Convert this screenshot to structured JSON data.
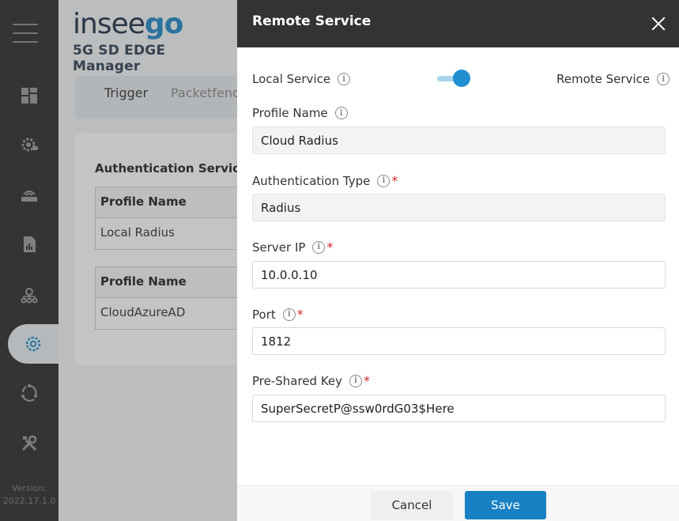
{
  "sidebar": {
    "icons": [
      "menu-icon",
      "dashboard-icon",
      "gear-cloud-icon",
      "router-icon",
      "report-icon",
      "network-icon",
      "settings-icon",
      "sync-icon",
      "tools-icon"
    ],
    "version_label": "Version:",
    "version_number": "2022.17.1.0"
  },
  "background": {
    "logo_main": "insee",
    "logo_accent": "go",
    "product_name": "5G SD EDGE Manager",
    "tabs": [
      {
        "label": "Trigger"
      },
      {
        "label": "Packetfence"
      }
    ],
    "section_title": "Authentication Service",
    "tables": [
      {
        "header": "Profile Name",
        "row": "Local Radius"
      },
      {
        "header": "Profile Name",
        "row": "CloudAzureAD"
      }
    ]
  },
  "modal": {
    "title": "Remote Service",
    "toggle": {
      "left_label": "Local Service",
      "right_label": "Remote Service",
      "selected": "Remote Service"
    },
    "fields": {
      "profile_name": {
        "label": "Profile Name",
        "value": "Cloud Radius",
        "required": false
      },
      "auth_type": {
        "label": "Authentication Type",
        "value": "Radius",
        "required": true
      },
      "server_ip": {
        "label": "Server IP",
        "value": "10.0.0.10",
        "required": true
      },
      "port": {
        "label": "Port",
        "value": "1812",
        "required": true
      },
      "psk": {
        "label": "Pre-Shared Key",
        "value": "SuperSecretP@ssw0rdG03$Here",
        "required": true
      }
    },
    "required_mark": "*",
    "info_glyph": "i",
    "cancel_label": "Cancel",
    "save_label": "Save"
  },
  "colors": {
    "primary": "#1781c4",
    "header": "#333333",
    "sidebar": "#2c2c2c",
    "required": "#d0282e"
  }
}
